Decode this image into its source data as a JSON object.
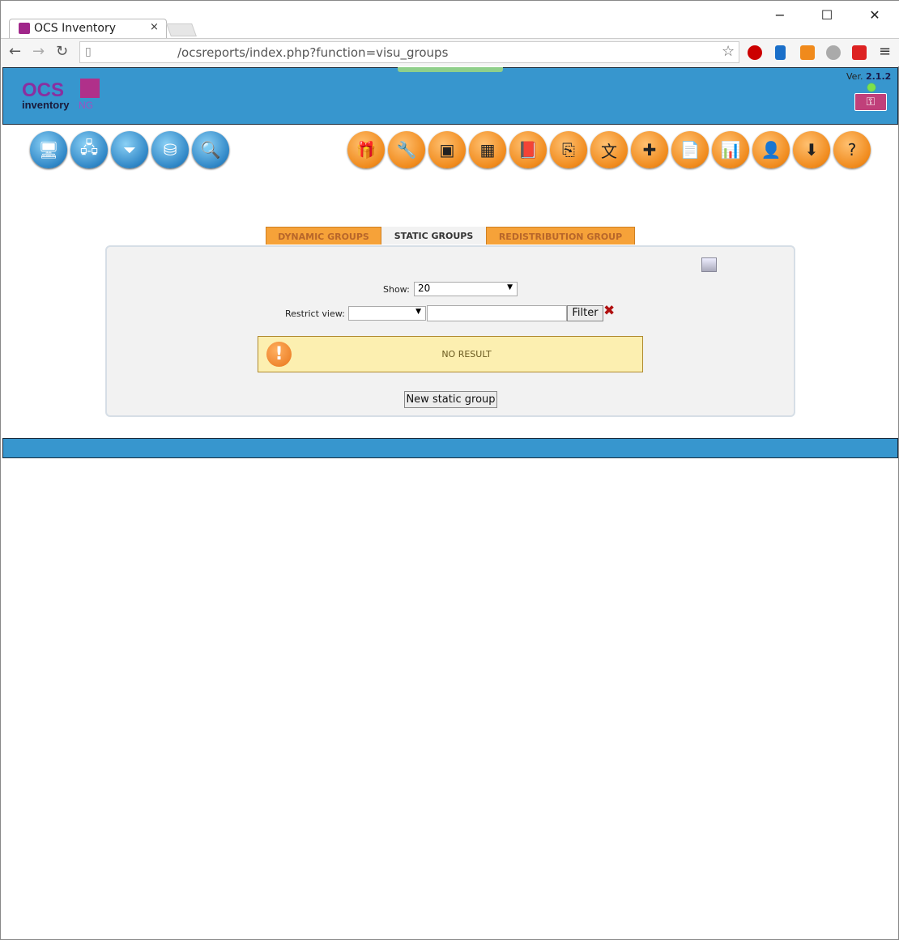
{
  "browser": {
    "tab_title": "OCS Inventory",
    "url": "/ocsreports/index.php?function=visu_groups",
    "minimize": "−",
    "maximize": "☐",
    "close": "✕",
    "tab_close": "×"
  },
  "header": {
    "version_label": "Ver.",
    "version": "2.1.2",
    "logo_text": "OCS inventory NG"
  },
  "menu_left": [
    {
      "icon": "computers-icon",
      "glyph": "🖥"
    },
    {
      "icon": "network-icon",
      "glyph": "🖧"
    },
    {
      "icon": "filter-icon",
      "glyph": "⏷"
    },
    {
      "icon": "database-icon",
      "glyph": "⛁"
    },
    {
      "icon": "search-icon",
      "glyph": "🔍"
    }
  ],
  "menu_right": [
    {
      "icon": "gift-icon",
      "glyph": "🎁"
    },
    {
      "icon": "wrench-icon",
      "glyph": "🔧"
    },
    {
      "icon": "network-card-icon",
      "glyph": "▣"
    },
    {
      "icon": "packages-icon",
      "glyph": "▦"
    },
    {
      "icon": "book-icon",
      "glyph": "📕"
    },
    {
      "icon": "copy-icon",
      "glyph": "⎘"
    },
    {
      "icon": "translate-icon",
      "glyph": "文"
    },
    {
      "icon": "puzzle-icon",
      "glyph": "✚"
    },
    {
      "icon": "document-icon",
      "glyph": "📄"
    },
    {
      "icon": "chart-icon",
      "glyph": "📊"
    },
    {
      "icon": "user-icon",
      "glyph": "👤"
    },
    {
      "icon": "download-icon",
      "glyph": "⬇"
    },
    {
      "icon": "help-icon",
      "glyph": "?"
    }
  ],
  "tabs": [
    {
      "label": "DYNAMIC GROUPS",
      "active": false
    },
    {
      "label": "STATIC GROUPS",
      "active": true
    },
    {
      "label": "REDISTRIBUTION GROUP",
      "active": false
    }
  ],
  "panel": {
    "show_label": "Show:",
    "show_value": "20",
    "restrict_label": "Restrict view:",
    "restrict_value": "",
    "filter_value": "",
    "filter_button": "Filter",
    "clear_icon": "✖",
    "message": "NO RESULT",
    "new_button": "New static group"
  },
  "colors": {
    "header_blue": "#3796ce",
    "tab_orange": "#f6a239",
    "message_bg": "#fcefb0"
  }
}
